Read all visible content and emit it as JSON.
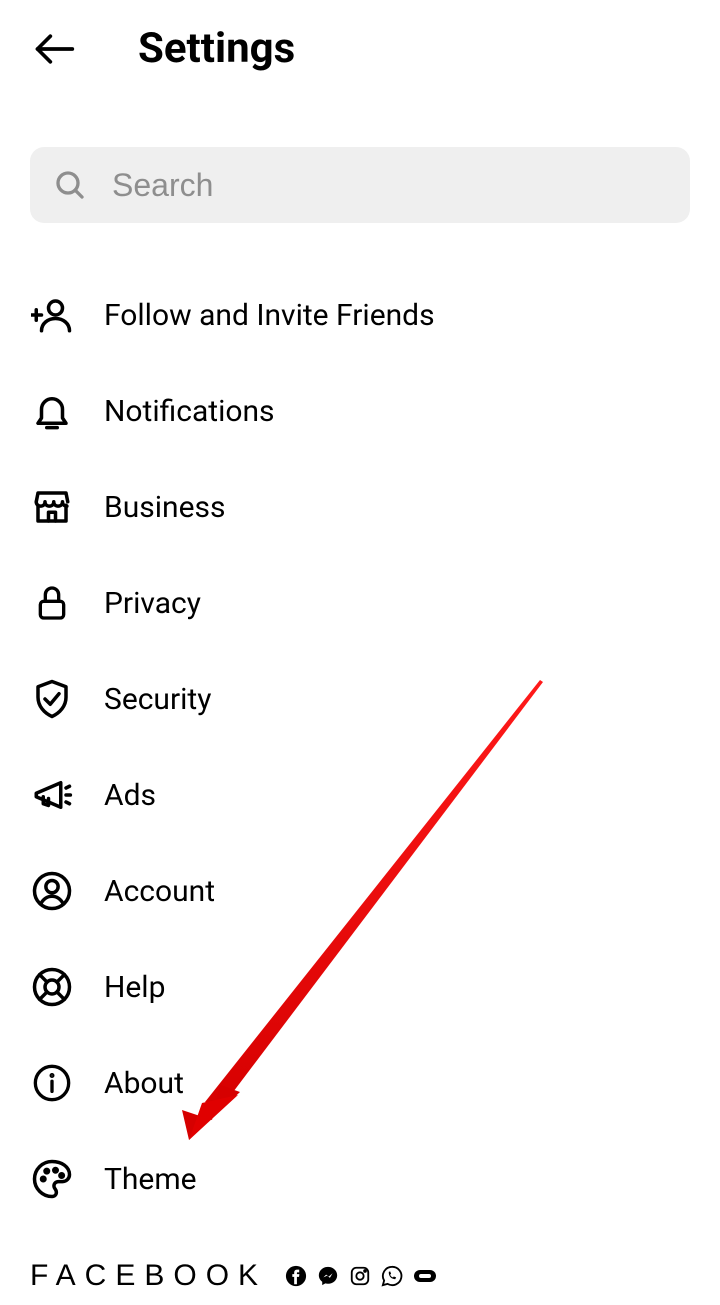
{
  "header": {
    "title": "Settings"
  },
  "search": {
    "placeholder": "Search",
    "value": ""
  },
  "menu": {
    "items": [
      {
        "label": "Follow and Invite Friends"
      },
      {
        "label": "Notifications"
      },
      {
        "label": "Business"
      },
      {
        "label": "Privacy"
      },
      {
        "label": "Security"
      },
      {
        "label": "Ads"
      },
      {
        "label": "Account"
      },
      {
        "label": "Help"
      },
      {
        "label": "About"
      },
      {
        "label": "Theme"
      }
    ]
  },
  "footer": {
    "brand": "FACEBOOK"
  }
}
